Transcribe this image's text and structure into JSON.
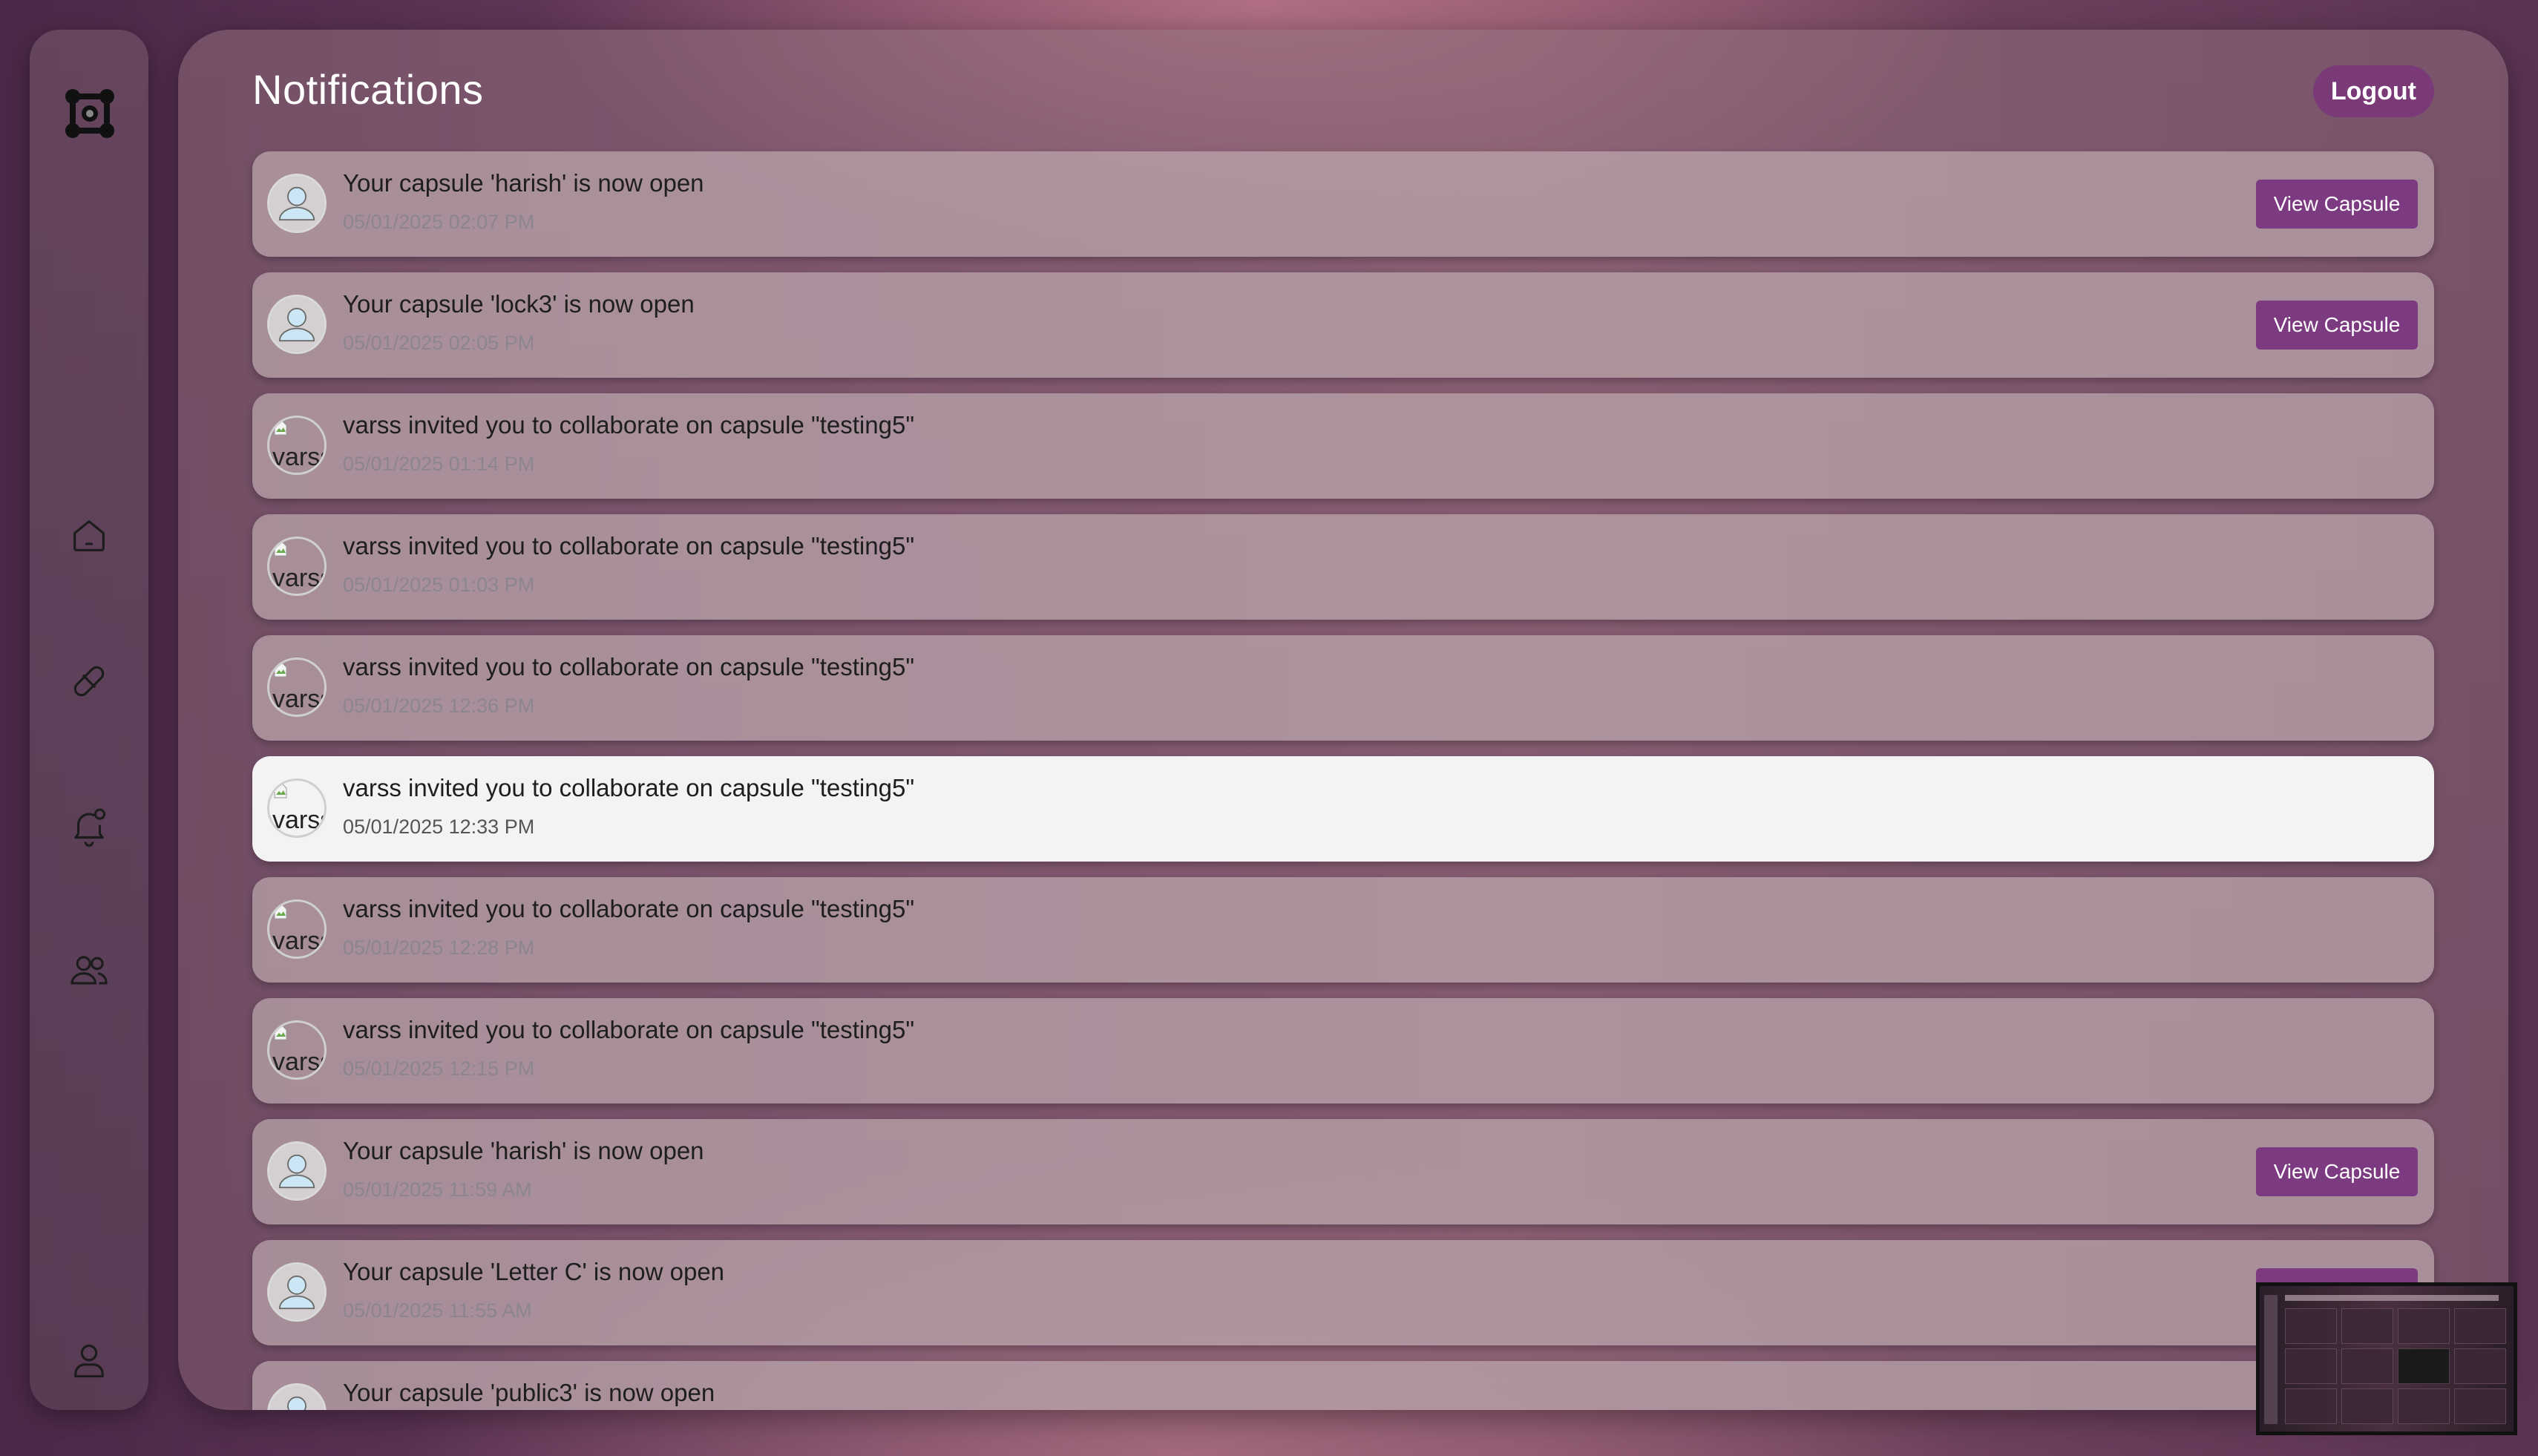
{
  "page": {
    "title": "Notifications",
    "logout_label": "Logout"
  },
  "sidebar": {
    "items": [
      {
        "name": "home",
        "icon": "home-icon"
      },
      {
        "name": "capsules",
        "icon": "pill-icon"
      },
      {
        "name": "notifications",
        "icon": "bell-icon"
      },
      {
        "name": "friends",
        "icon": "users-icon"
      },
      {
        "name": "profile",
        "icon": "user-icon"
      }
    ]
  },
  "notifications": [
    {
      "message": "Your capsule 'harish' is now open",
      "time": "05/01/2025 02:07 PM",
      "avatar": "default",
      "action": "View Capsule"
    },
    {
      "message": "Your capsule 'lock3' is now open",
      "time": "05/01/2025 02:05 PM",
      "avatar": "default",
      "action": "View Capsule"
    },
    {
      "message": "varss invited you to collaborate on capsule \"testing5\"",
      "time": "05/01/2025 01:14 PM",
      "avatar": "broken",
      "avatar_alt": "varss"
    },
    {
      "message": "varss invited you to collaborate on capsule \"testing5\"",
      "time": "05/01/2025 01:03 PM",
      "avatar": "broken",
      "avatar_alt": "varss"
    },
    {
      "message": "varss invited you to collaborate on capsule \"testing5\"",
      "time": "05/01/2025 12:36 PM",
      "avatar": "broken",
      "avatar_alt": "varss"
    },
    {
      "message": "varss invited you to collaborate on capsule \"testing5\"",
      "time": "05/01/2025 12:33 PM",
      "avatar": "broken",
      "avatar_alt": "varss",
      "highlight": true
    },
    {
      "message": "varss invited you to collaborate on capsule \"testing5\"",
      "time": "05/01/2025 12:28 PM",
      "avatar": "broken",
      "avatar_alt": "varss"
    },
    {
      "message": "varss invited you to collaborate on capsule \"testing5\"",
      "time": "05/01/2025 12:15 PM",
      "avatar": "broken",
      "avatar_alt": "varss"
    },
    {
      "message": "Your capsule 'harish' is now open",
      "time": "05/01/2025 11:59 AM",
      "avatar": "default",
      "action": "View Capsule"
    },
    {
      "message": "Your capsule 'Letter C' is now open",
      "time": "05/01/2025 11:55 AM",
      "avatar": "default",
      "action": "View Capsule"
    },
    {
      "message": "Your capsule 'public3' is now open",
      "time": "",
      "avatar": "default"
    }
  ],
  "colors": {
    "accent": "#7c3a80",
    "logout_bg": "#7a3a78"
  }
}
